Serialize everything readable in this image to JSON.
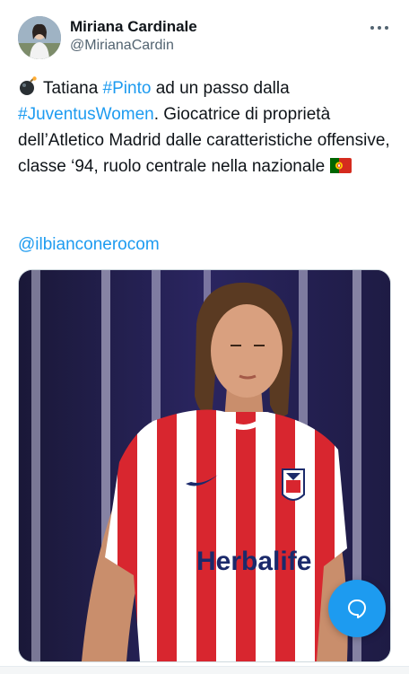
{
  "author": {
    "display_name": "Miriana Cardinale",
    "handle": "@MirianaCardin",
    "avatar_icon": "profile-photo"
  },
  "header": {
    "more_icon": "more-horizontal-icon"
  },
  "tweet": {
    "emoji_start": "bomb-emoji",
    "text_1": "Tatiana ",
    "hashtag_1": "#Pinto",
    "text_2": " ad un passo dalla",
    "hashtag_2": "#JuventusWomen",
    "text_3": ". Giocatrice di proprietà dell’Atletico Madrid dalle caratteristiche offensive, classe ‘94, ruolo centrale nella nazionale",
    "emoji_end": "portugal-flag-emoji",
    "mention": "@ilbianconerocom"
  },
  "media": {
    "jersey_sponsor": "Herbalife"
  },
  "fab": {
    "icon": "chat-bubble-icon"
  },
  "colors": {
    "link": "#1d9bf0",
    "text": "#0f1419",
    "secondary": "#536471",
    "accent": "#1d9bf0"
  }
}
